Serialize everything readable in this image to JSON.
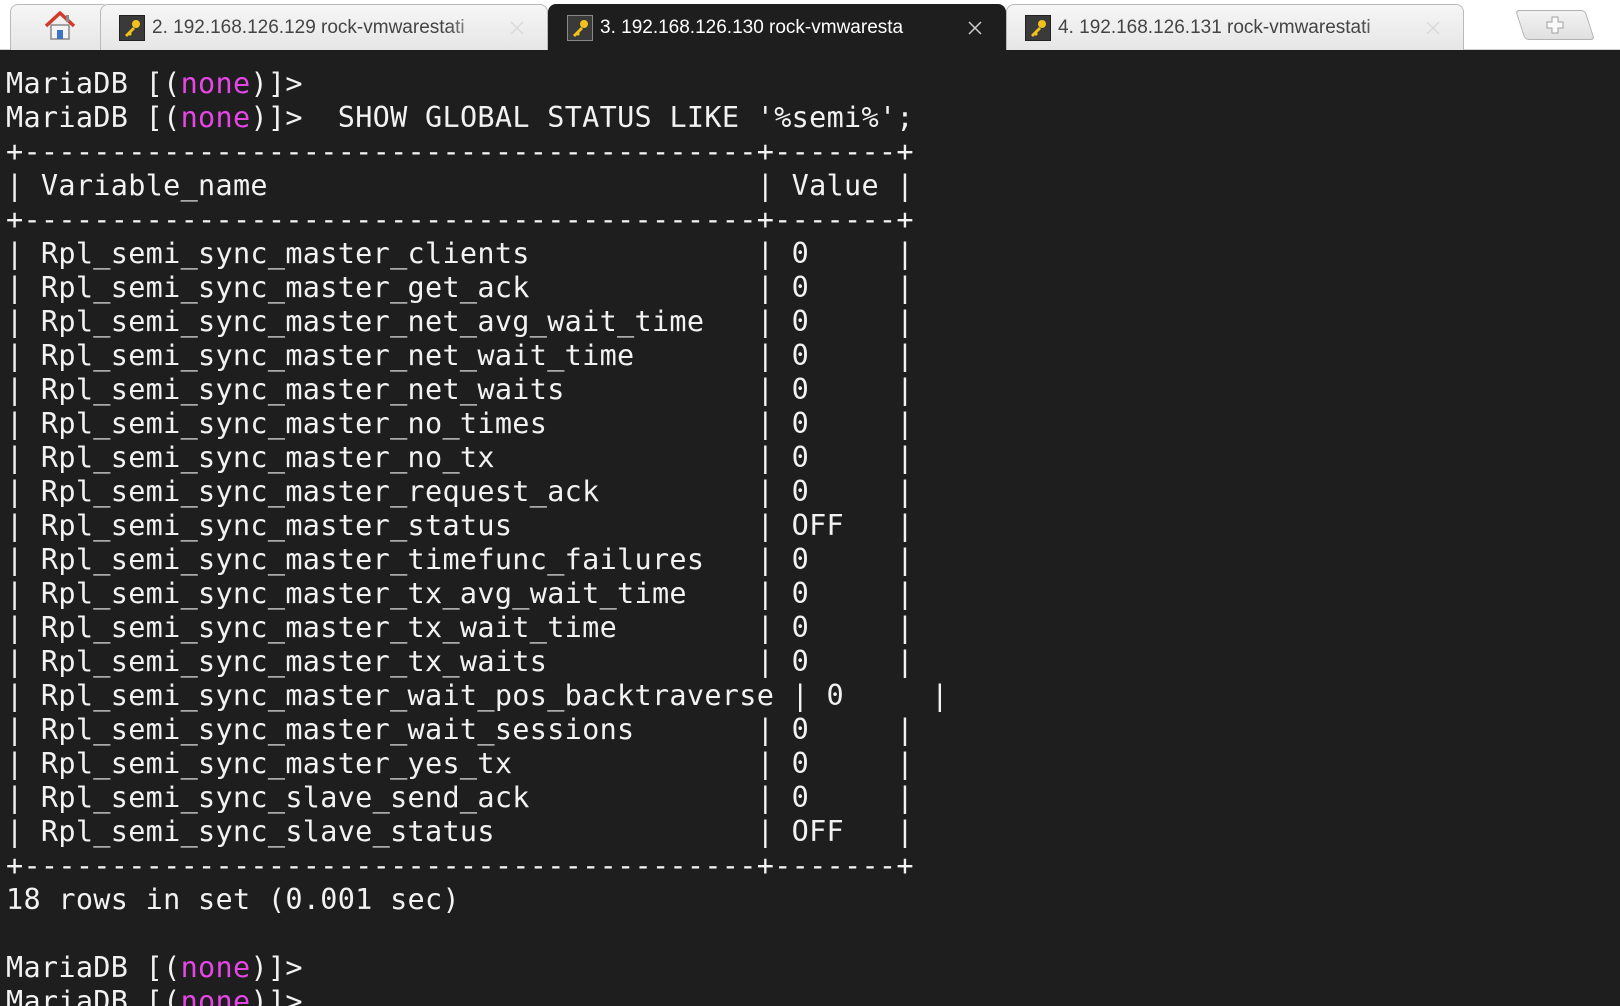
{
  "tabs": {
    "home_icon": "home-icon",
    "items": [
      {
        "label": "2. 192.168.126.129 rock-vmwarestati",
        "active": false
      },
      {
        "label": "3. 192.168.126.130 rock-vmwaresta",
        "active": true
      },
      {
        "label": "4. 192.168.126.131 rock-vmwarestati",
        "active": false
      }
    ],
    "new_tab_icon": "plus-icon"
  },
  "terminal": {
    "prompt_before": "MariaDB [(",
    "prompt_db": "none",
    "prompt_after": ")]>",
    "command": "  SHOW GLOBAL STATUS LIKE '%semi%';",
    "border_line": "+------------------------------------------+-------+",
    "header_line": "| Variable_name                            | Value |",
    "rows": [
      "| Rpl_semi_sync_master_clients             | 0     |",
      "| Rpl_semi_sync_master_get_ack             | 0     |",
      "| Rpl_semi_sync_master_net_avg_wait_time   | 0     |",
      "| Rpl_semi_sync_master_net_wait_time       | 0     |",
      "| Rpl_semi_sync_master_net_waits           | 0     |",
      "| Rpl_semi_sync_master_no_times            | 0     |",
      "| Rpl_semi_sync_master_no_tx               | 0     |",
      "| Rpl_semi_sync_master_request_ack         | 0     |",
      "| Rpl_semi_sync_master_status              | OFF   |",
      "| Rpl_semi_sync_master_timefunc_failures   | 0     |",
      "| Rpl_semi_sync_master_tx_avg_wait_time    | 0     |",
      "| Rpl_semi_sync_master_tx_wait_time        | 0     |",
      "| Rpl_semi_sync_master_tx_waits            | 0     |",
      "| Rpl_semi_sync_master_wait_pos_backtraverse | 0     |",
      "| Rpl_semi_sync_master_wait_sessions       | 0     |",
      "| Rpl_semi_sync_master_yes_tx              | 0     |",
      "| Rpl_semi_sync_slave_send_ack             | 0     |",
      "| Rpl_semi_sync_slave_status               | OFF   |"
    ],
    "summary": "18 rows in set (0.001 sec)"
  },
  "colors": {
    "background": "#1e1e1e",
    "text": "#f2f2f2",
    "prompt_highlight": "#e546e5"
  }
}
